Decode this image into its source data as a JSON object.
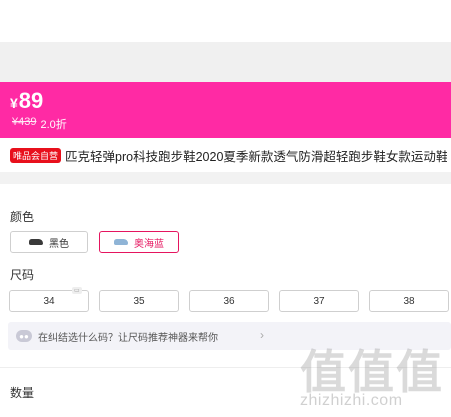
{
  "price": {
    "currency_symbol": "¥",
    "current": "89",
    "original": "¥439",
    "discount": "2.0折"
  },
  "product": {
    "badge": "唯品会自营",
    "title": "匹克轻弹pro科技跑步鞋2020夏季新款透气防滑超轻跑步鞋女款运动鞋"
  },
  "colors": {
    "label": "颜色",
    "options": [
      {
        "label": "黑色",
        "selected": false
      },
      {
        "label": "奥海蓝",
        "selected": true
      }
    ]
  },
  "sizes": {
    "label": "尺码",
    "options": [
      "34",
      "35",
      "36",
      "37",
      "38"
    ]
  },
  "size_helper": {
    "text": "在纠结选什么码？让尺码推荐神器来帮你",
    "chevron": "›"
  },
  "quantity": {
    "label": "数量"
  },
  "watermark": {
    "glyphs": "值值值",
    "url": "zhizhizhi.com"
  },
  "style": {
    "accent": "#ff2aa4",
    "selected_border": "#e5155f",
    "badge_red": "#e8101c"
  }
}
